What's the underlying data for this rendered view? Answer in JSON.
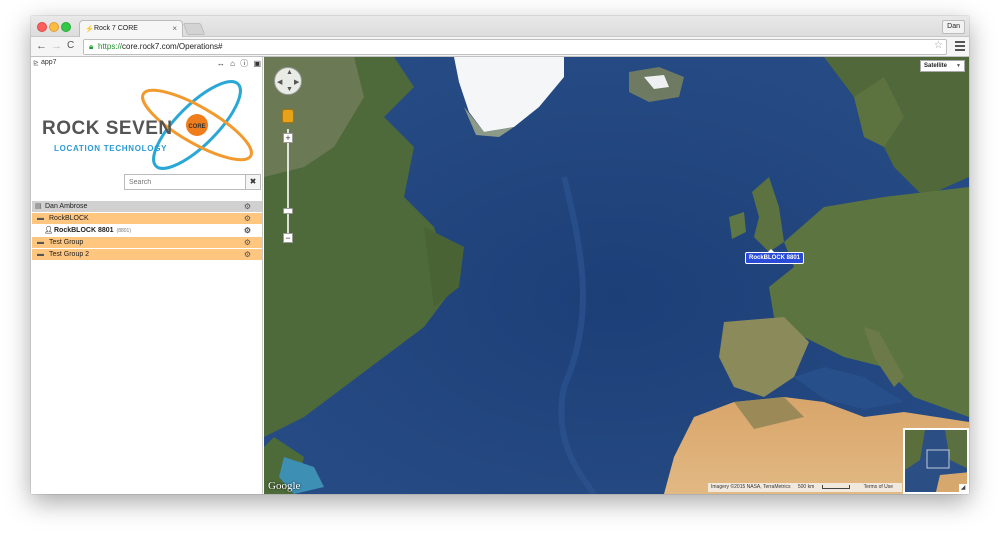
{
  "browser": {
    "tab_title": "Rock 7 CORE",
    "tab_close": "×",
    "profile_name": "Dan",
    "url_scheme": "https://",
    "url_rest": "core.rock7.com/Operations#",
    "back": "←",
    "forward": "→",
    "reload": "C",
    "star": "☆"
  },
  "sidebar": {
    "app_user": "app7",
    "logo": {
      "title": "ROCK SEVEN",
      "subtitle": "LOCATION TECHNOLOGY",
      "badge": "CORE"
    },
    "search": {
      "placeholder": "Search",
      "clear": "✖"
    },
    "tree": [
      {
        "kind": "account",
        "label": "Dan Ambrose",
        "icon": "account-icon"
      },
      {
        "kind": "group",
        "label": "RockBLOCK",
        "icon": "folder-icon"
      },
      {
        "kind": "device",
        "label": "RockBLOCK 8801",
        "sub": "(8801)",
        "icon": "person-icon"
      },
      {
        "kind": "group",
        "label": "Test Group",
        "icon": "folder-icon"
      },
      {
        "kind": "group",
        "label": "Test Group 2",
        "icon": "folder-icon"
      }
    ]
  },
  "map": {
    "map_type": "Satellite",
    "marker_label": "RockBLOCK 8801",
    "google_logo": "Google",
    "attribution": "Imagery ©2015 NASA, TerraMetrics",
    "scale": "500 km",
    "terms": "Terms of Use",
    "zoom_in": "+",
    "zoom_out": "−"
  }
}
